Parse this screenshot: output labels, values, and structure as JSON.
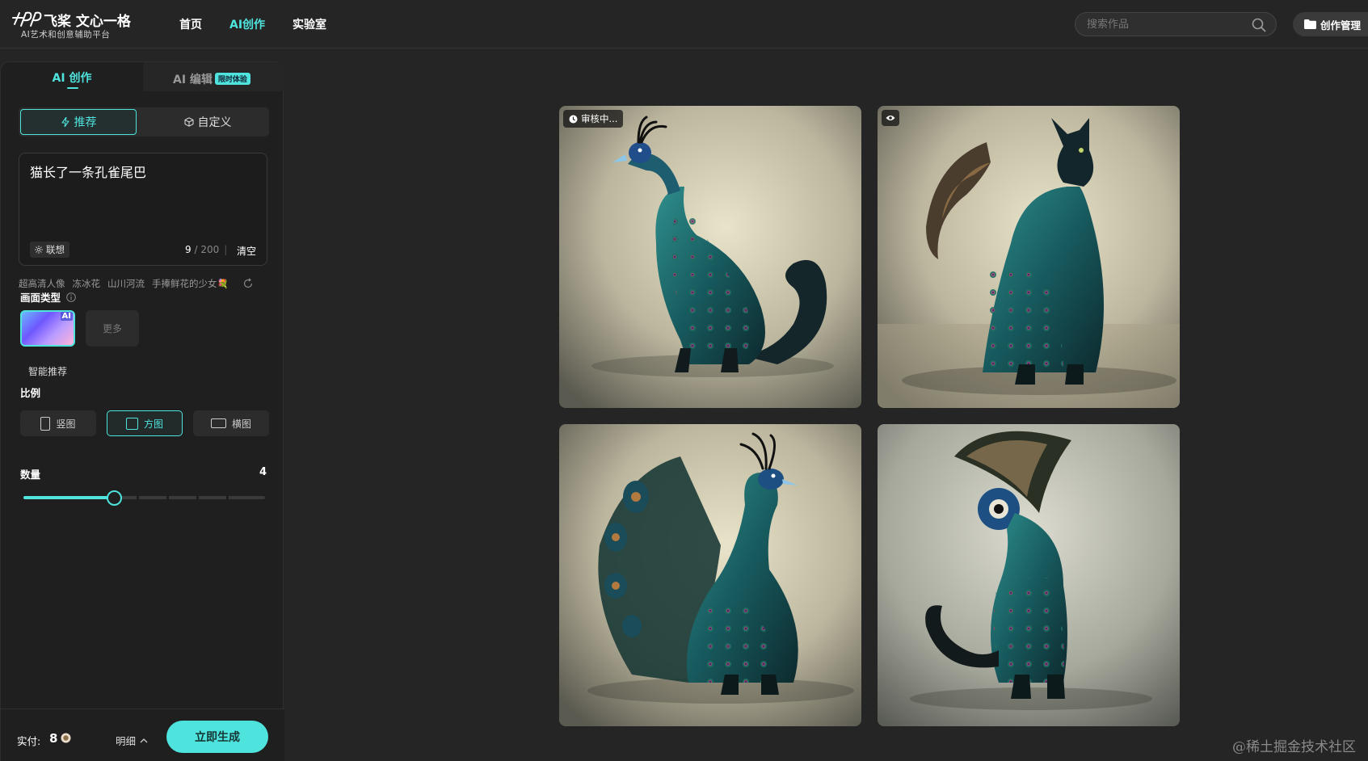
{
  "header": {
    "logo_name": "飞桨 文心一格",
    "logo_sub": "AI艺术和创意辅助平台",
    "nav": [
      "首页",
      "AI创作",
      "实验室"
    ],
    "search_placeholder": "搜索作品",
    "manage_label": "创作管理"
  },
  "sidebar": {
    "tabs": {
      "create": "AI 创作",
      "edit": "AI 编辑",
      "edit_badge": "限时体验"
    },
    "modes": {
      "recommend": "推荐",
      "custom": "自定义"
    },
    "prompt": {
      "value": "猫长了一条孔雀尾巴",
      "count": "9",
      "max": "200",
      "assoc": "联想",
      "clear": "清空"
    },
    "suggestions": [
      "超高清人像",
      "冻冰花",
      "山川河流",
      "手捧鲜花的少女💐"
    ],
    "type_section": {
      "label": "画面类型",
      "card_label": "智能推荐",
      "card_tag": "AI",
      "more": "更多"
    },
    "ratio_section": {
      "label": "比例",
      "options": [
        "竖图",
        "方图",
        "横图"
      ],
      "selected": "方图"
    },
    "count_section": {
      "label": "数量",
      "value": "4",
      "slider_fraction": 0.375
    },
    "footer": {
      "pay_label": "实付:",
      "pay_value": "8",
      "detail": "明细",
      "generate": "立即生成"
    }
  },
  "gallery": {
    "status_text": "审核中..."
  },
  "watermark": "@稀土掘金技术社区",
  "colors": {
    "accent": "#4fe3dd",
    "background": "#252525",
    "panel": "#1f1f1f"
  }
}
